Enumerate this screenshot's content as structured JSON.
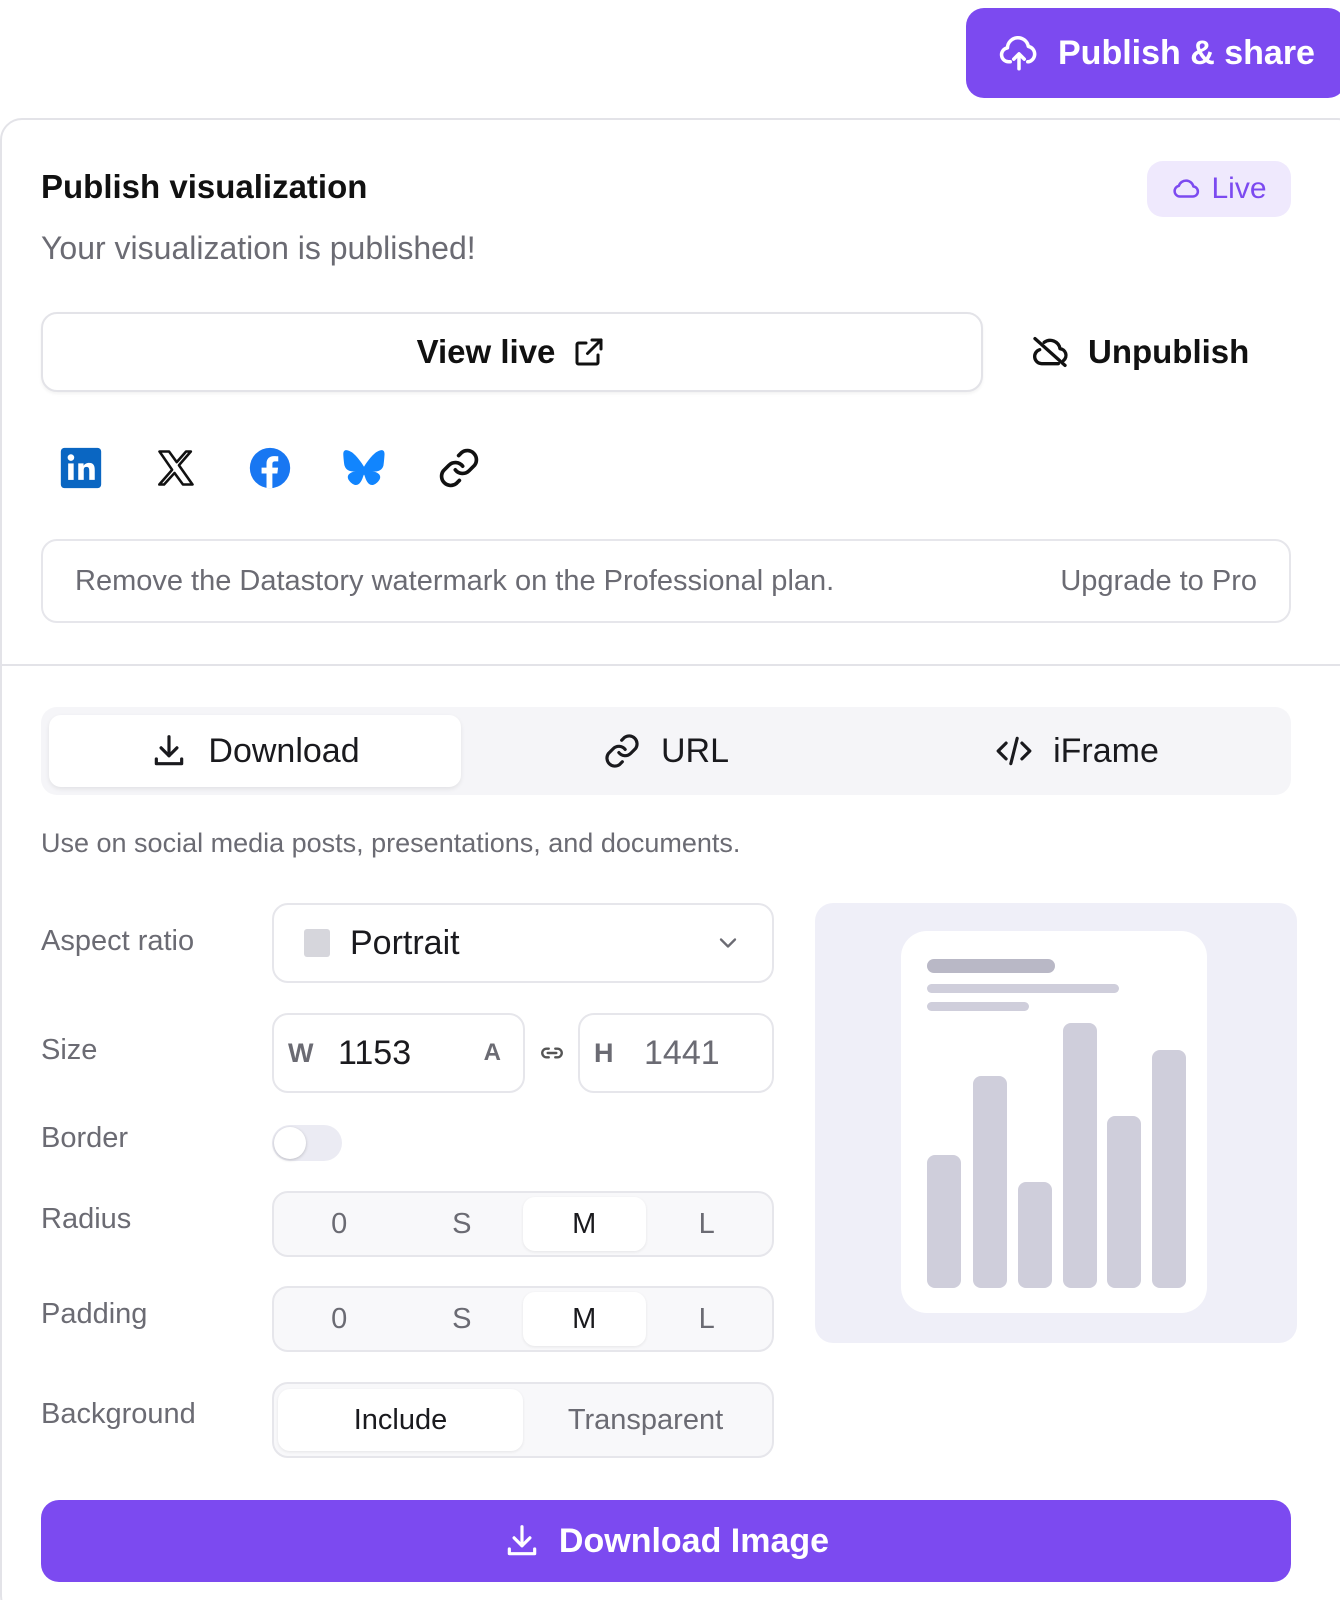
{
  "header": {
    "publish_label": "Publish & share"
  },
  "panel": {
    "title": "Publish visualization",
    "status_text": "Your visualization is published!",
    "badge": "Live",
    "view_live_label": "View live",
    "unpublish_label": "Unpublish",
    "share_icons": [
      "linkedin-icon",
      "x-icon",
      "facebook-icon",
      "bluesky-icon",
      "link-icon"
    ],
    "watermark_text": "Remove the Datastory watermark on the Professional plan.",
    "upgrade_label": "Upgrade to Pro"
  },
  "tabs": [
    {
      "label": "Download",
      "icon": "download-icon",
      "active": true
    },
    {
      "label": "URL",
      "icon": "link-icon",
      "active": false
    },
    {
      "label": "iFrame",
      "icon": "code-icon",
      "active": false
    }
  ],
  "download": {
    "description": "Use on social media posts, presentations, and documents.",
    "aspect_ratio": {
      "label": "Aspect ratio",
      "value": "Portrait"
    },
    "size": {
      "label": "Size",
      "w_prefix": "W",
      "width": "1153",
      "w_suffix": "A",
      "h_prefix": "H",
      "height": "1441"
    },
    "border": {
      "label": "Border",
      "enabled": false
    },
    "radius": {
      "label": "Radius",
      "options": [
        "0",
        "S",
        "M",
        "L"
      ],
      "selected": "M"
    },
    "padding": {
      "label": "Padding",
      "options": [
        "0",
        "S",
        "M",
        "L"
      ],
      "selected": "M"
    },
    "background": {
      "label": "Background",
      "options": [
        "Include",
        "Transparent"
      ],
      "selected": "Include"
    },
    "button_label": "Download Image"
  },
  "colors": {
    "accent": "#7c4af0",
    "badge_bg": "#efe9fd",
    "preview_bg": "#efeff8",
    "preview_bar": "#cfcedb"
  }
}
